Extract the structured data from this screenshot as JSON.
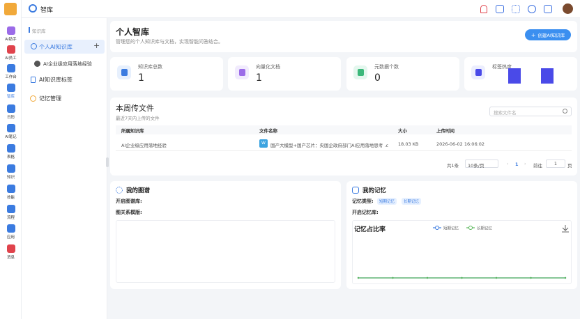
{
  "topbar": {
    "title": "智库"
  },
  "rail": {
    "items": [
      {
        "label": "AI助手",
        "icon": "ai-assistant-icon",
        "color": "#9b6be8"
      },
      {
        "label": "AI员工",
        "icon": "ai-employee-icon",
        "color": "#e0434c"
      },
      {
        "label": "工作台",
        "icon": "workbench-icon",
        "color": "#3b7be0"
      },
      {
        "label": "智库",
        "icon": "knowledge-base-icon",
        "color": "#3b7be0"
      },
      {
        "label": "日历",
        "icon": "calendar-icon",
        "color": "#3b7be0"
      },
      {
        "label": "AI笔记",
        "icon": "notes-icon",
        "color": "#3b7be0"
      },
      {
        "label": "表格",
        "icon": "table-icon",
        "color": "#3b7be0"
      },
      {
        "label": "知识",
        "icon": "knowledge-icon",
        "color": "#3b7be0"
      },
      {
        "label": "技能",
        "icon": "skills-icon",
        "color": "#3b7be0"
      },
      {
        "label": "流程",
        "icon": "workflow-icon",
        "color": "#3b7be0"
      },
      {
        "label": "应用",
        "icon": "apps-icon",
        "color": "#3b7be0"
      },
      {
        "label": "消息",
        "icon": "message-icon",
        "color": "#e0434c"
      }
    ]
  },
  "sidebar": {
    "section": "知识库",
    "items": [
      {
        "label": "个人AI知识库",
        "active": true
      },
      {
        "label": "AI企业级应用落地经验"
      },
      {
        "label": "AI知识库标签"
      },
      {
        "label": "记忆管理"
      }
    ]
  },
  "header": {
    "title": "个人智库",
    "subtitle": "管理您的个人知识库与文档，实现智能问答结合。",
    "create_button": "创建AI知识库"
  },
  "stats": [
    {
      "label": "知识库总数",
      "value": "1",
      "color": "#3b7be0",
      "bg": "#e7f0fd"
    },
    {
      "label": "向量化文档",
      "value": "1",
      "color": "#9b6be8",
      "bg": "#f1ebfd"
    },
    {
      "label": "元数据个数",
      "value": "0",
      "color": "#3bb87a",
      "bg": "#e4f7ee"
    },
    {
      "label": "标签热度",
      "value": "",
      "color": "#4a4ae8",
      "bg": "#eceefe"
    }
  ],
  "uploads": {
    "title": "本周传文件",
    "subtitle": "最近7天内上传的文件",
    "search_placeholder": "搜索文件名",
    "columns": [
      "所属知识库",
      "文件名称",
      "大小",
      "上传时间"
    ],
    "rows": [
      {
        "kb": "AI企业级应用落地经验",
        "name": "国产大模型+国产芯片：央国企政府部门AI应用落地思考 .c",
        "size": "18.03 KB",
        "time": "2026-06-02 16:06:02"
      }
    ],
    "pager": {
      "total": "共1条",
      "per_page": "10条/页",
      "page": "1",
      "goto_label": "前往",
      "goto_value": "1",
      "unit": "页"
    }
  },
  "graph": {
    "title": "我的图谱",
    "open_label": "开启图谱库:",
    "template_label": "图关系模版:"
  },
  "memory": {
    "title": "我的记忆",
    "type_label": "记忆类型:",
    "types": [
      "短期记忆",
      "长期记忆"
    ],
    "open_label": "开启记忆库:",
    "chart_title": "记忆占比率"
  },
  "chart_data": {
    "type": "line",
    "title": "记忆占比率",
    "series": [
      {
        "name": "短期记忆",
        "values": [
          0,
          0,
          0,
          0,
          0,
          0,
          0
        ],
        "color": "#3b7be0"
      },
      {
        "name": "长期记忆",
        "values": [
          0,
          0,
          0,
          0,
          0,
          0,
          0
        ],
        "color": "#5bb85b"
      }
    ]
  }
}
